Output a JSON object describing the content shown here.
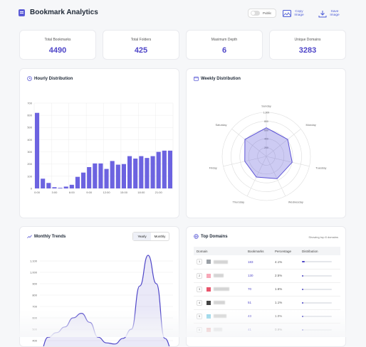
{
  "header": {
    "title": "Bookmark Analytics",
    "public_label": "Public",
    "copy_label": "Copy Image",
    "save_label": "Save Image"
  },
  "stats": [
    {
      "label": "Total Bookmarks",
      "value": "4490"
    },
    {
      "label": "Total Folders",
      "value": "425"
    },
    {
      "label": "Maximum Depth",
      "value": "6"
    },
    {
      "label": "Unique Domains",
      "value": "3283"
    }
  ],
  "hourly": {
    "title": "Hourly Distribution",
    "chart_data": {
      "type": "bar",
      "categories": [
        "0:00",
        "1:00",
        "2:00",
        "3:00",
        "4:00",
        "5:00",
        "6:00",
        "7:00",
        "8:00",
        "9:00",
        "10:00",
        "11:00",
        "12:00",
        "13:00",
        "14:00",
        "15:00",
        "16:00",
        "17:00",
        "18:00",
        "19:00",
        "20:00",
        "21:00",
        "22:00",
        "23:00"
      ],
      "tick_labels": [
        "0:00",
        "3:00",
        "6:00",
        "9:00",
        "12:00",
        "15:00",
        "18:00",
        "21:00"
      ],
      "values": [
        620,
        80,
        45,
        10,
        5,
        15,
        30,
        95,
        130,
        175,
        205,
        205,
        160,
        225,
        195,
        200,
        265,
        245,
        265,
        250,
        265,
        300,
        310,
        310
      ],
      "ylim": [
        0,
        700
      ],
      "yticks": [
        "0",
        "100",
        "200",
        "300",
        "400",
        "500",
        "600",
        "700"
      ],
      "color": "#6c63e0"
    }
  },
  "weekly": {
    "title": "Weekly Distribution",
    "chart_data": {
      "type": "radar",
      "categories": [
        "Sunday",
        "Monday",
        "Tuesday",
        "Wednesday",
        "Thursday",
        "Friday",
        "Saturday"
      ],
      "values": [
        650,
        620,
        600,
        560,
        520,
        500,
        620
      ],
      "max": 1000,
      "rings": [
        "200",
        "400",
        "600",
        "800",
        "1,000"
      ],
      "color": "#5b52d6"
    }
  },
  "monthly": {
    "title": "Monthly Trends",
    "tabs": [
      "Yearly",
      "Monthly"
    ],
    "active_tab": "Yearly",
    "chart_data": {
      "type": "area",
      "ylim": [
        400,
        1100
      ],
      "yticks": [
        "1,100",
        "1,000",
        "900",
        "800",
        "700",
        "600",
        "500",
        "400"
      ],
      "x": [
        0,
        1,
        2,
        3,
        4,
        5,
        6,
        7,
        8,
        9,
        10,
        11,
        12,
        13,
        14,
        15,
        16
      ],
      "values": [
        300,
        430,
        470,
        520,
        600,
        640,
        560,
        430,
        380,
        370,
        420,
        500,
        880,
        1150,
        900,
        420,
        300
      ],
      "color": "#4f46c8"
    }
  },
  "domains": {
    "title": "Top Domains",
    "showing": "Showing top 8 domains",
    "columns": [
      "Domain",
      "Bookmarks",
      "Percentage",
      "Distribution"
    ],
    "rows": [
      {
        "rank": "1",
        "count": "183",
        "pct": "4.1%",
        "fill": 0.041,
        "color": "#9aa0a6"
      },
      {
        "rank": "2",
        "count": "130",
        "pct": "2.5%",
        "fill": 0.025,
        "color": "#f7a8b8"
      },
      {
        "rank": "3",
        "count": "70",
        "pct": "1.6%",
        "fill": 0.016,
        "color": "#e9546b"
      },
      {
        "rank": "4",
        "count": "51",
        "pct": "1.1%",
        "fill": 0.011,
        "color": "#444"
      },
      {
        "rank": "5",
        "count": "43",
        "pct": "1.0%",
        "fill": 0.01,
        "color": "#8fd3e8"
      },
      {
        "rank": "6",
        "count": "41",
        "pct": "0.9%",
        "fill": 0.009,
        "color": "#e8a2a2"
      }
    ]
  }
}
